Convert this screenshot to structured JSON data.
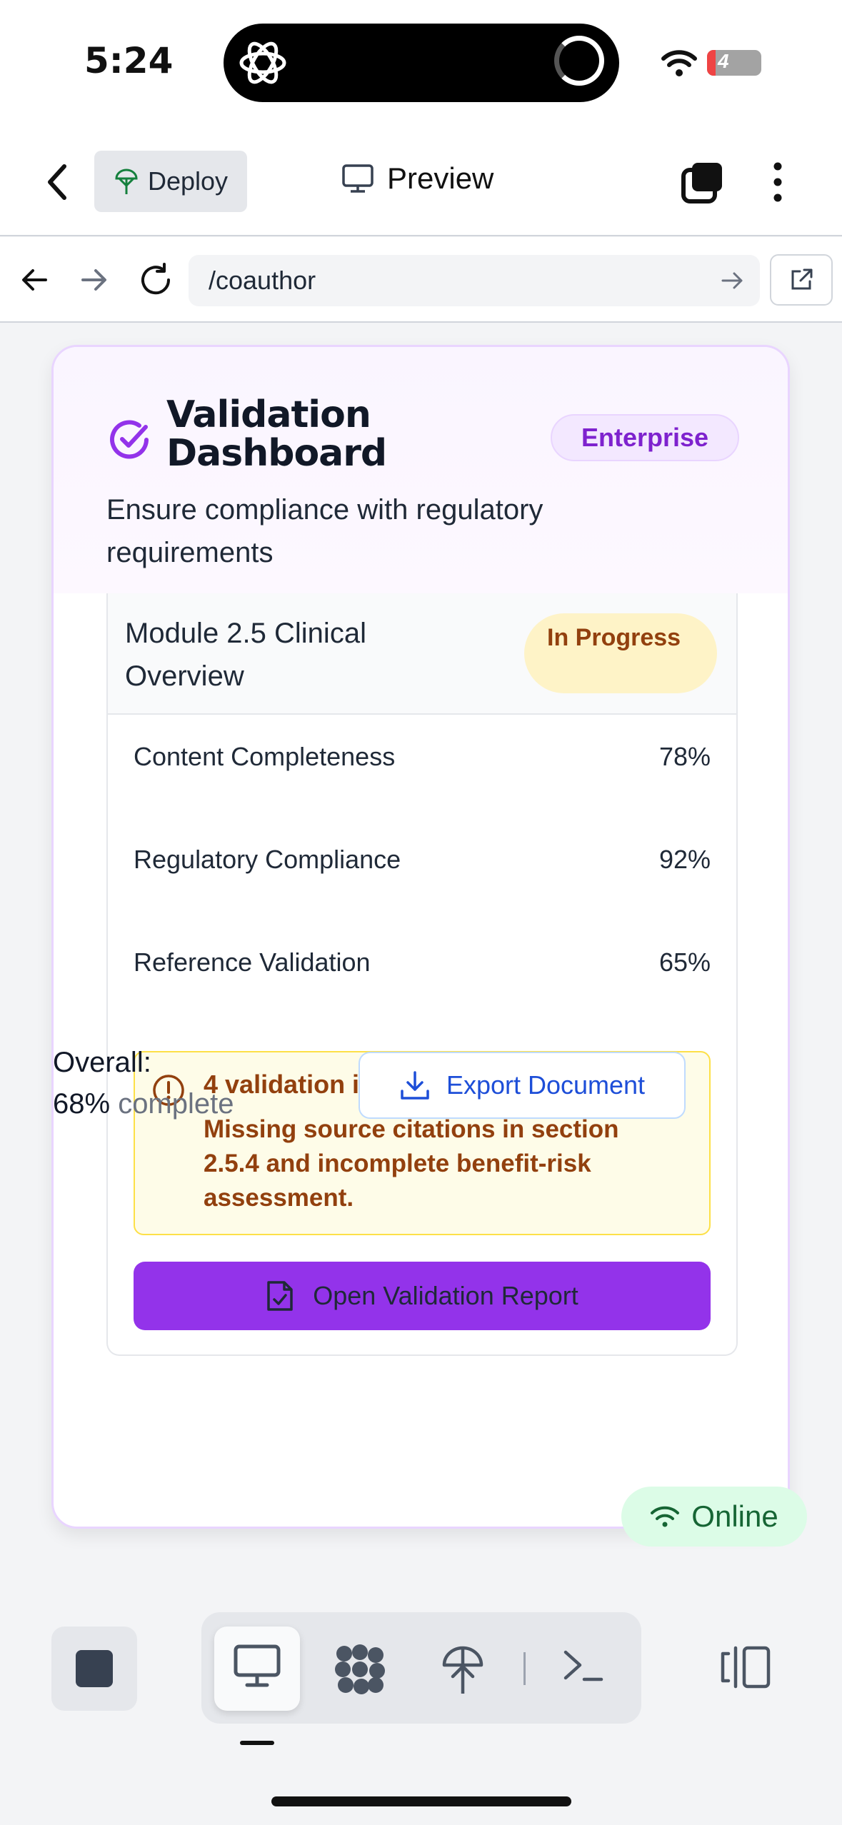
{
  "status_bar": {
    "time": "5:24",
    "battery": "4"
  },
  "nav": {
    "deploy_label": "Deploy",
    "preview_label": "Preview"
  },
  "browser": {
    "url": "/coauthor"
  },
  "card": {
    "title": "Validation Dashboard",
    "badge": "Enterprise",
    "subtitle": "Ensure compliance with regulatory requirements"
  },
  "module": {
    "title": "Module 2.5 Clinical Overview",
    "status": "In Progress",
    "metrics": [
      {
        "label": "Content Completeness",
        "value": "78%"
      },
      {
        "label": "Regulatory Compliance",
        "value": "92%"
      },
      {
        "label": "Reference Validation",
        "value": "65%"
      }
    ],
    "alert": {
      "title": "4 validation issues require attention",
      "description": "Missing source citations in section 2.5.4 and incomplete benefit-risk assessment."
    },
    "open_report_label": "Open Validation Report"
  },
  "overall": {
    "label": "Overall:",
    "value": "68%",
    "suffix": "complete"
  },
  "export_label": "Export Document",
  "online_label": "Online",
  "colors": {
    "accent": "#9333ea",
    "warning": "#92400e",
    "online": "#166534",
    "link": "#1d4ed8"
  }
}
